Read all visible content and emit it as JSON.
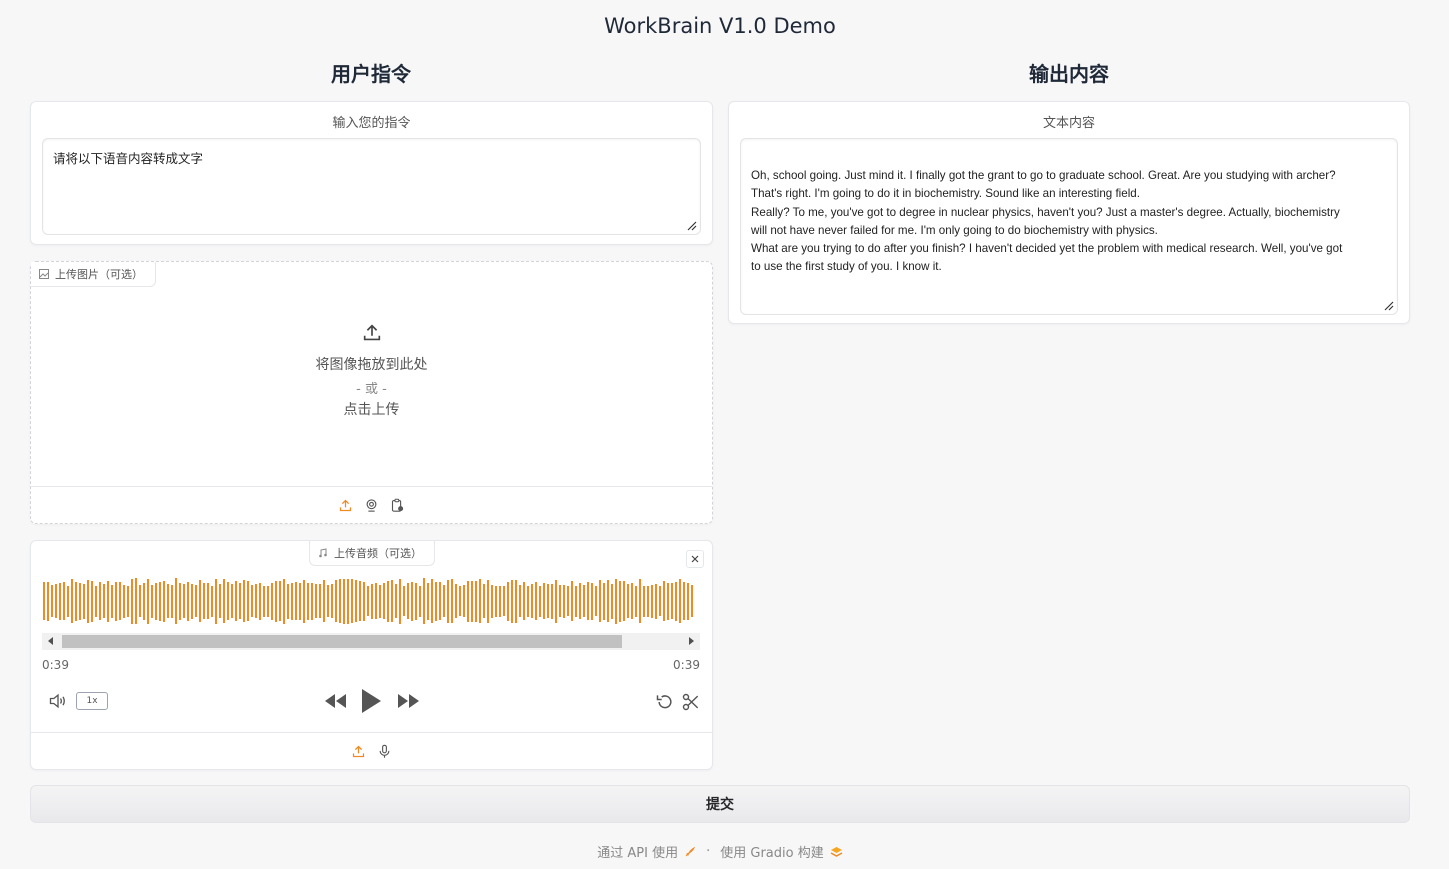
{
  "app": {
    "title": "WorkBrain V1.0 Demo"
  },
  "left": {
    "title": "用户指令",
    "instruction": {
      "label": "输入您的指令",
      "value": "请将以下语音内容转成文字"
    },
    "image_upload": {
      "tab_label": "上传图片（可选）",
      "drop_text": "将图像拖放到此处",
      "or_text": "- 或 -",
      "click_text": "点击上传"
    },
    "audio_upload": {
      "tab_label": "上传音频（可选）",
      "current_time": "0:39",
      "duration": "0:39",
      "rate": "1x"
    }
  },
  "right": {
    "title": "输出内容",
    "output": {
      "label": "文本内容",
      "lines": [
        "Oh, school going. Just mind it. I finally got the grant to go to graduate school. Great. Are you studying with archer?",
        "That's right. I'm going to do it in biochemistry. Sound like an interesting field.",
        "Really? To me, you've got to degree in nuclear physics, haven't you? Just a master's degree. Actually, biochemistry",
        "will not have never failed for me. I'm only going to do biochemistry with physics.",
        "What are you trying to do after you finish? I haven't decided yet the problem with medical research. Well, you've got",
        "to use the first study of you. I know it."
      ]
    }
  },
  "submit": {
    "label": "提交"
  },
  "footer": {
    "api_text": "通过 API 使用",
    "separator": "·",
    "built_with": "使用 Gradio 构建"
  },
  "colors": {
    "accent": "#f08a24",
    "waveform": "#f08a24"
  },
  "icons": [
    "upload-icon",
    "webcam-icon",
    "clipboard-icon",
    "music-icon",
    "image-icon",
    "close-icon",
    "volume-icon",
    "rewind-icon",
    "play-icon",
    "fast-forward-icon",
    "undo-icon",
    "scissors-icon",
    "microphone-icon",
    "rocket-icon",
    "gradio-logo-icon"
  ]
}
